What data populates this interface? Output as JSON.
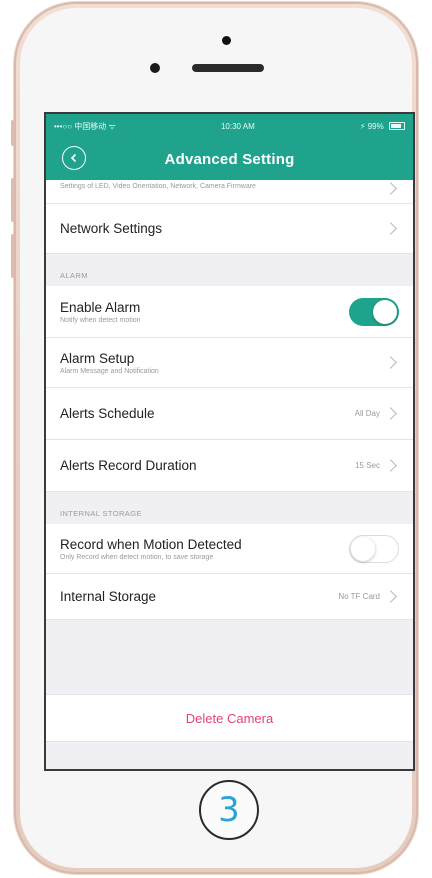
{
  "status_bar": {
    "carrier": "•••○○ 中国移动 ᯤ",
    "time": "10:30 AM",
    "battery": "⚡ 99%"
  },
  "nav": {
    "title": "Advanced Setting"
  },
  "top_row": {
    "subtitle": "Settings of LED, Video Orientation, Network, Camera Firmware"
  },
  "network_row": {
    "title": "Network Settings"
  },
  "alarm_section": {
    "header": "ALARM",
    "enable_alarm": {
      "title": "Enable Alarm",
      "subtitle": "Notify when detect motion",
      "enabled": true
    },
    "alarm_setup": {
      "title": "Alarm Setup",
      "subtitle": "Alarm Message and Notification"
    },
    "alerts_schedule": {
      "title": "Alerts Schedule",
      "value": "All Day"
    },
    "alerts_record_duration": {
      "title": "Alerts Record Duration",
      "value": "15 Sec"
    }
  },
  "storage_section": {
    "header": "INTERNAL STORAGE",
    "record_motion": {
      "title": "Record when Motion Detected",
      "subtitle": "Only Record when detect motion, to save storage",
      "enabled": false
    },
    "internal_storage": {
      "title": "Internal Storage",
      "value": "No TF Card"
    }
  },
  "delete": {
    "label": "Delete Camera"
  },
  "home_button": {
    "label": "3"
  },
  "colors": {
    "accent": "#1fa38c",
    "delete": "#e4417a",
    "badge_number": "#2aa3d6"
  }
}
